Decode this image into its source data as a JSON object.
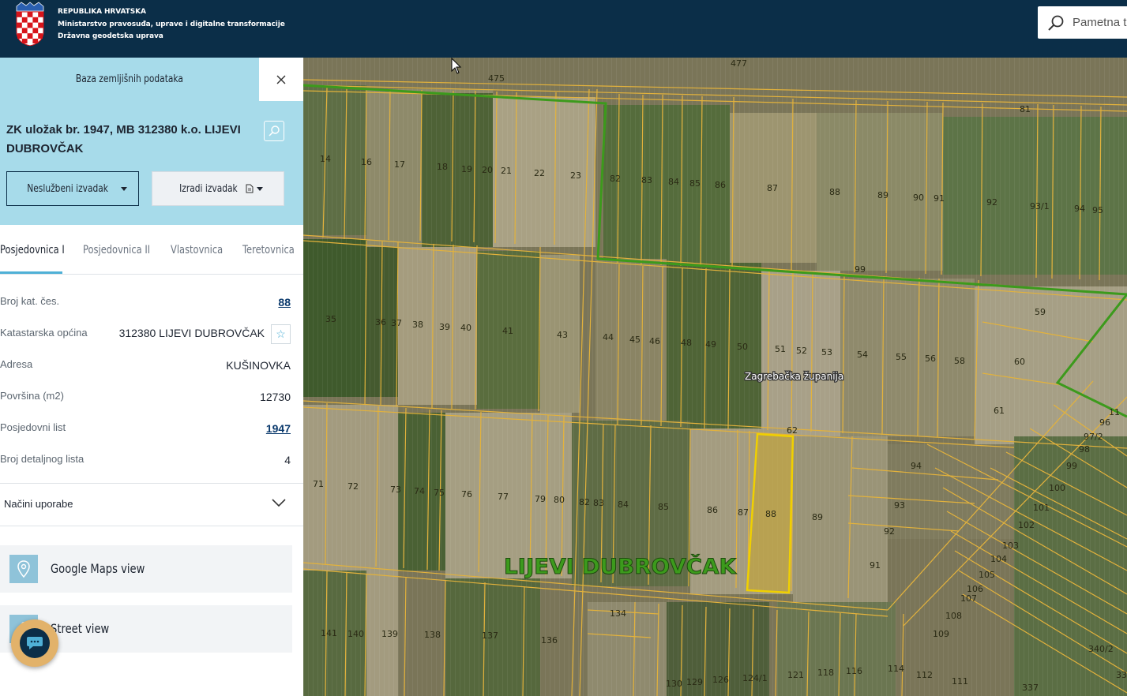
{
  "header": {
    "org_line1": "REPUBLIKA HRVATSKA",
    "org_line2": "Ministarstvo pravosuđa, uprave i digitalne transformacije",
    "org_line3": "Državna geodetska uprava",
    "search_placeholder": "Pametna t",
    "search_icon": "search-icon"
  },
  "panel": {
    "title": "Baza zemljišnih podataka",
    "close_icon": "close-icon",
    "record_title": "ZK uložak br. 1947, MB 312380 k.o. LIJEVI DUBROVČAK",
    "btn_unofficial": "Neslužbeni izvadak",
    "btn_create": "Izradi izvadak",
    "tabs": [
      "Posjedovnica I",
      "Posjedovnica II",
      "Vlastovnica",
      "Teretovnica"
    ],
    "active_tab": "Posjedovnica I",
    "rows": [
      {
        "label": "Broj kat. čes.",
        "value": "88"
      },
      {
        "label": "Katastarska općina",
        "value": "312380 LIJEVI DUBROVČAK"
      },
      {
        "label": "Adresa",
        "value": "KUŠINOVKA"
      },
      {
        "label": "Površina (m2)",
        "value": "12730"
      },
      {
        "label": "Posjedovni list",
        "value": "1947"
      },
      {
        "label": "Broj detaljnog lista",
        "value": "4"
      }
    ],
    "usage_label": "Načini uporabe",
    "google_maps": "Google Maps view",
    "street_view": "Street view"
  },
  "map": {
    "county_label": "Zagrebačka županija",
    "place_label": "LIJEVI DUBROVČAK",
    "colors": {
      "parcel_line": "#e3b23c",
      "boundary": "#3c9a1c",
      "selected": "#f0d000"
    },
    "parcels": [
      "14",
      "16",
      "17",
      "18",
      "19",
      "20",
      "21",
      "22",
      "23",
      "82",
      "83",
      "84",
      "85",
      "86",
      "87",
      "88",
      "89",
      "90",
      "91",
      "92",
      "93/1",
      "94",
      "95",
      "475",
      "477",
      "81",
      "99",
      "35",
      "36",
      "37",
      "38",
      "39",
      "40",
      "41",
      "43",
      "44",
      "45",
      "46",
      "48",
      "49",
      "50",
      "51",
      "52",
      "53",
      "54",
      "55",
      "56",
      "58",
      "59",
      "60",
      "61",
      "62",
      "96",
      "97/2",
      "98",
      "99",
      "100",
      "101",
      "102",
      "103",
      "104",
      "105",
      "106",
      "107",
      "108",
      "109",
      "71",
      "72",
      "73",
      "74",
      "75",
      "76",
      "77",
      "79",
      "80",
      "82",
      "83",
      "84",
      "85",
      "86",
      "87",
      "88",
      "89",
      "94",
      "93",
      "92",
      "91",
      "134",
      "141",
      "140",
      "139",
      "138",
      "137",
      "136",
      "130",
      "129",
      "126",
      "124/1",
      "121",
      "118",
      "116",
      "114",
      "112",
      "111",
      "337",
      "340/2",
      "33",
      "11"
    ]
  }
}
